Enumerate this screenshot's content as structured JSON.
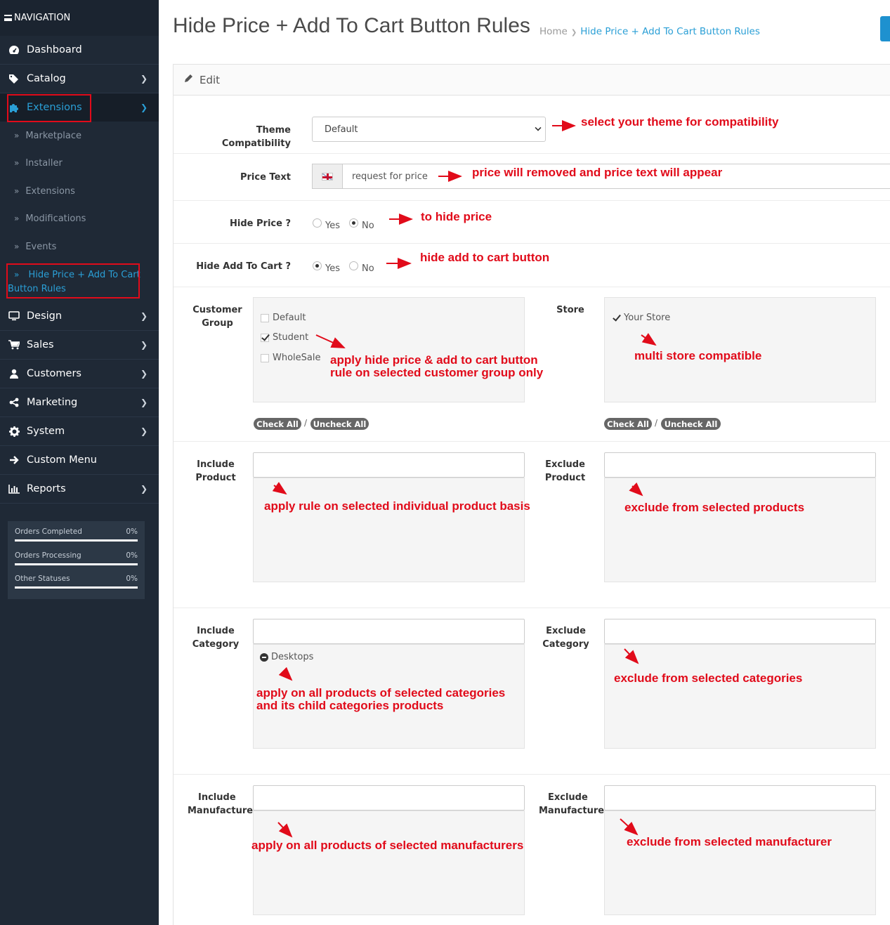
{
  "sidebar": {
    "header": "NAVIGATION",
    "items": [
      {
        "label": "Dashboard",
        "icon": "dashboard-icon"
      },
      {
        "label": "Catalog",
        "icon": "tags-icon"
      },
      {
        "label": "Extensions",
        "icon": "puzzle-icon"
      },
      {
        "label": "Design",
        "icon": "monitor-icon"
      },
      {
        "label": "Sales",
        "icon": "cart-icon"
      },
      {
        "label": "Customers",
        "icon": "user-icon"
      },
      {
        "label": "Marketing",
        "icon": "share-icon"
      },
      {
        "label": "System",
        "icon": "gear-icon"
      },
      {
        "label": "Custom Menu",
        "icon": "arrow-right-icon"
      },
      {
        "label": "Reports",
        "icon": "bar-chart-icon"
      }
    ],
    "subitems": [
      {
        "label": "Marketplace"
      },
      {
        "label": "Installer"
      },
      {
        "label": "Extensions"
      },
      {
        "label": "Modifications"
      },
      {
        "label": "Events"
      },
      {
        "label": "Hide Price + Add To Cart",
        "label2": "Button Rules"
      }
    ],
    "stats": [
      {
        "label": "Orders Completed",
        "value": "0%"
      },
      {
        "label": "Orders Processing",
        "value": "0%"
      },
      {
        "label": "Other Statuses",
        "value": "0%"
      }
    ]
  },
  "header": {
    "title": "Hide Price + Add To Cart Button Rules",
    "breadcrumb": {
      "home": "Home",
      "current": "Hide Price + Add To Cart Button Rules"
    }
  },
  "panel": {
    "heading": "Edit",
    "theme": {
      "label": "Theme Compatibility",
      "value": "Default"
    },
    "price_text": {
      "label": "Price Text",
      "value": "request for price"
    },
    "hide_price": {
      "label": "Hide Price ?",
      "yes": "Yes",
      "no": "No",
      "selected": "No"
    },
    "hide_cart": {
      "label": "Hide Add To Cart ?",
      "yes": "Yes",
      "no": "No",
      "selected": "Yes"
    },
    "customer_group": {
      "label1": "Customer",
      "label2": "Group",
      "options": [
        {
          "label": "Default",
          "checked": false
        },
        {
          "label": "Student",
          "checked": true
        },
        {
          "label": "WholeSale",
          "checked": false
        }
      ]
    },
    "store": {
      "label": "Store",
      "options": [
        {
          "label": "Your Store",
          "checked": true
        }
      ]
    },
    "check_all": "Check All",
    "uncheck_all": "Uncheck All",
    "slash": "/",
    "include_product": {
      "label1": "Include",
      "label2": "Product"
    },
    "exclude_product": {
      "label1": "Exclude",
      "label2": "Product"
    },
    "include_category": {
      "label1": "Include",
      "label2": "Category",
      "items": [
        "Desktops"
      ]
    },
    "exclude_category": {
      "label1": "Exclude",
      "label2": "Category"
    },
    "include_manufacturer": {
      "label1": "Include",
      "label2": "Manufacturer"
    },
    "exclude_manufacturer": {
      "label1": "Exclude",
      "label2": "Manufacturer"
    }
  },
  "annotations": {
    "theme": "select your theme for compatibility",
    "price_text": "price will removed and price text will appear",
    "hide_price": "to hide price",
    "hide_cart": "hide add to cart button",
    "customer_group_1": "apply hide price & add to cart button",
    "customer_group_2": "rule on selected customer group only",
    "store": "multi store compatible",
    "include_product": "apply rule on selected individual product basis",
    "exclude_product": "exclude from selected products",
    "include_category_1": "apply on all products of selected categories",
    "include_category_2": "and its child categories products",
    "exclude_category": "exclude from selected categories",
    "include_manufacturer": "apply on all products of selected manufacturers",
    "exclude_manufacturer": "exclude from selected manufacturer"
  },
  "colors": {
    "sidebar_bg": "#1f2936",
    "accent": "#2a9fd6",
    "annotation": "#e10b1a"
  }
}
